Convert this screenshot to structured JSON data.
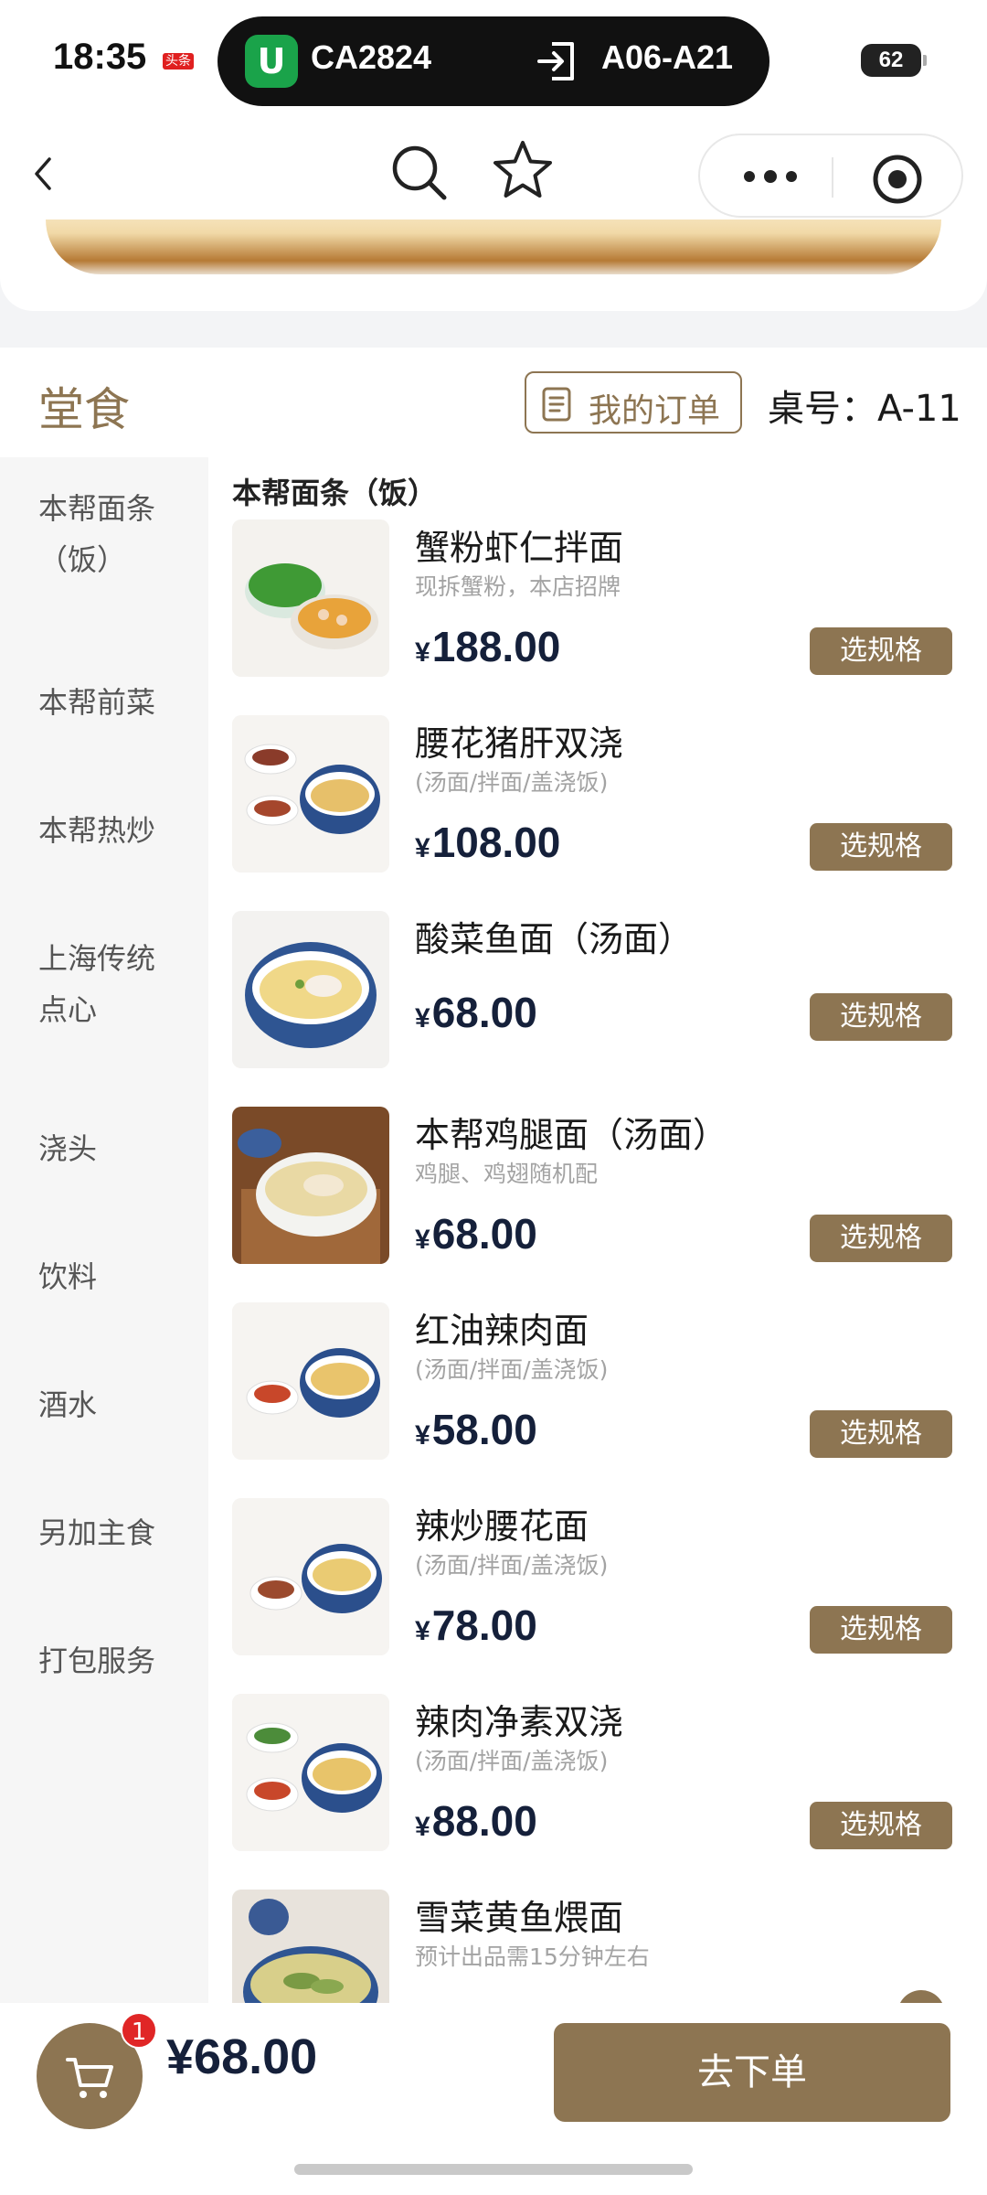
{
  "status_bar": {
    "time": "18:35",
    "tag": "头条",
    "flight_logo": "U",
    "flight_no": "CA2824",
    "gate": "A06-A21",
    "battery": "62"
  },
  "header": {
    "dine_title": "堂食",
    "my_order": "我的订单",
    "table_no": "桌号：A-11"
  },
  "categories": [
    {
      "line1": "本帮面条",
      "line2": "（饭）"
    },
    {
      "line1": "本帮前菜",
      "line2": ""
    },
    {
      "line1": "本帮热炒",
      "line2": ""
    },
    {
      "line1": "上海传统",
      "line2": "点心"
    },
    {
      "line1": "浇头",
      "line2": ""
    },
    {
      "line1": "饮料",
      "line2": ""
    },
    {
      "line1": "酒水",
      "line2": ""
    },
    {
      "line1": "另加主食",
      "line2": ""
    },
    {
      "line1": "打包服务",
      "line2": ""
    }
  ],
  "list_title": "本帮面条（饭）",
  "currency": "¥",
  "spec_label": "选规格",
  "items": [
    {
      "name": "蟹粉虾仁拌面",
      "desc": "现拆蟹粉，本店招牌",
      "price": "188.00"
    },
    {
      "name": "腰花猪肝双浇",
      "desc": "(汤面/拌面/盖浇饭)",
      "price": "108.00"
    },
    {
      "name": "酸菜鱼面（汤面）",
      "desc": "",
      "price": "68.00"
    },
    {
      "name": "本帮鸡腿面（汤面）",
      "desc": "鸡腿、鸡翅随机配",
      "price": "68.00"
    },
    {
      "name": "红油辣肉面",
      "desc": "(汤面/拌面/盖浇饭)",
      "price": "58.00"
    },
    {
      "name": "辣炒腰花面",
      "desc": "(汤面/拌面/盖浇饭)",
      "price": "78.00"
    },
    {
      "name": "辣肉净素双浇",
      "desc": "(汤面/拌面/盖浇饭)",
      "price": "88.00"
    },
    {
      "name": "雪菜黄鱼煨面",
      "desc": "预计出品需15分钟左右",
      "price": ""
    }
  ],
  "cart": {
    "badge": "1",
    "total": "¥68.00"
  },
  "checkout_label": "去下单",
  "colors": {
    "accent": "#8d7552",
    "price": "#15203a",
    "badge": "#e02626",
    "flight_logo": "#1aa34a"
  },
  "icons": [
    "back-icon",
    "search-icon",
    "star-icon",
    "more-icon",
    "target-icon",
    "order-list-icon",
    "cart-icon",
    "gate-exit-icon"
  ]
}
